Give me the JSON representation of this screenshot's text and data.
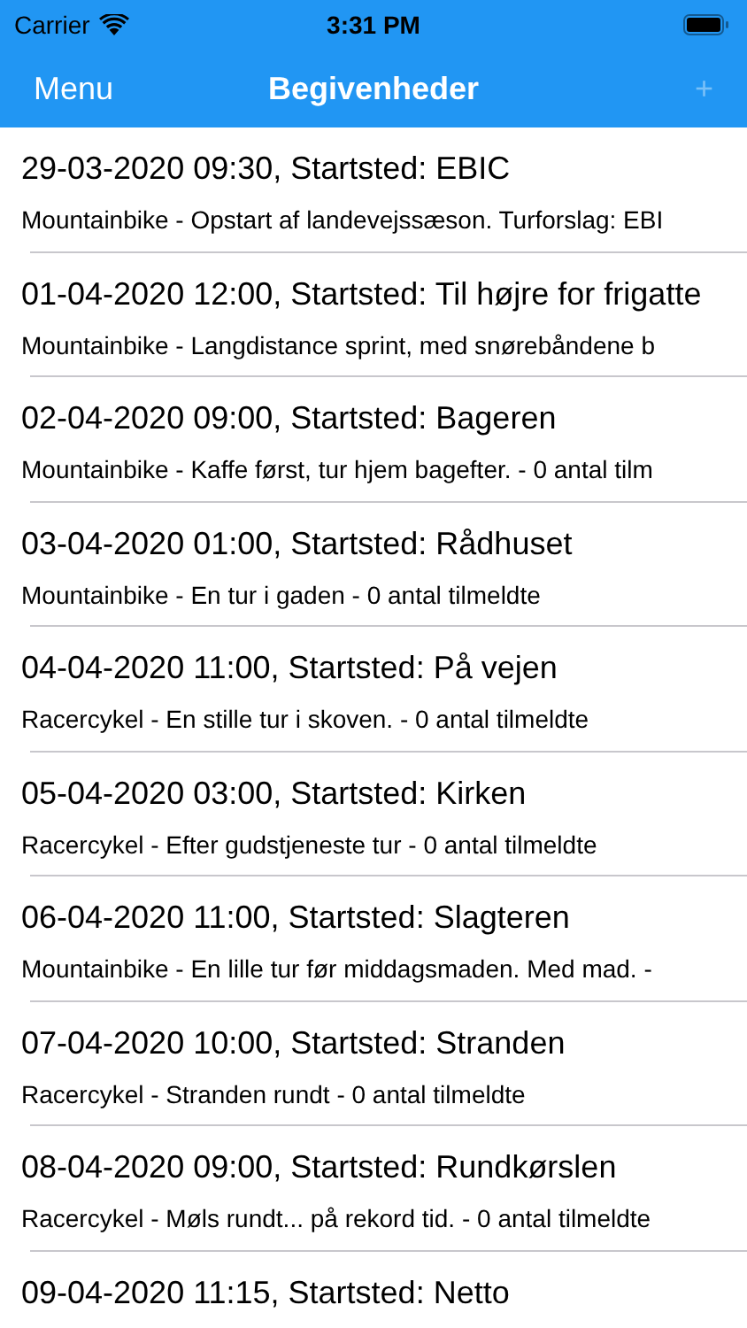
{
  "status_bar": {
    "carrier": "Carrier",
    "time": "3:31 PM"
  },
  "nav_bar": {
    "left_button": "Menu",
    "title": "Begivenheder",
    "right_button": {
      "label": "+",
      "disabled": true
    }
  },
  "events": [
    {
      "title": "29-03-2020 09:30, Startsted: EBIC",
      "subtitle": "Mountainbike - Opstart af landevejssæson. Turforslag: EBI"
    },
    {
      "title": "01-04-2020 12:00, Startsted: Til højre for frigatte",
      "subtitle": "Mountainbike - Langdistance sprint, med snørebåndene b"
    },
    {
      "title": "02-04-2020 09:00, Startsted: Bageren",
      "subtitle": "Mountainbike - Kaffe først, tur hjem bagefter. - 0 antal tilm"
    },
    {
      "title": "03-04-2020 01:00, Startsted: Rådhuset",
      "subtitle": "Mountainbike - En tur i gaden - 0 antal tilmeldte"
    },
    {
      "title": "04-04-2020 11:00, Startsted: På vejen",
      "subtitle": "Racercykel - En stille tur i skoven. - 0 antal tilmeldte"
    },
    {
      "title": "05-04-2020 03:00, Startsted: Kirken",
      "subtitle": "Racercykel - Efter gudstjeneste tur - 0 antal tilmeldte"
    },
    {
      "title": "06-04-2020 11:00, Startsted: Slagteren",
      "subtitle": "Mountainbike - En lille tur før middagsmaden. Med mad. -"
    },
    {
      "title": "07-04-2020 10:00, Startsted: Stranden",
      "subtitle": "Racercykel - Stranden rundt - 0 antal tilmeldte"
    },
    {
      "title": "08-04-2020 09:00, Startsted: Rundkørslen",
      "subtitle": "Racercykel - Møls rundt... på rekord tid. - 0 antal tilmeldte"
    },
    {
      "title": "09-04-2020 11:15, Startsted: Netto"
    }
  ]
}
